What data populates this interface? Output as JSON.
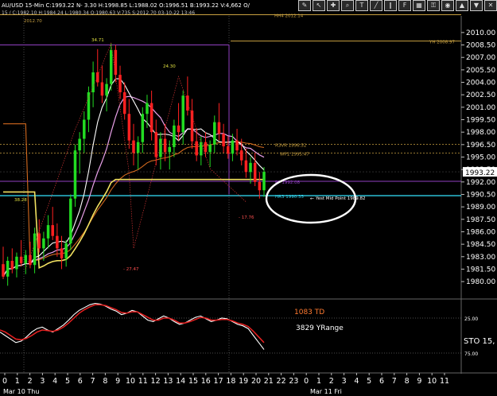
{
  "header": {
    "symbol_line": "AU/USD 15-Min  C:1993.22 N-  3.30 H:1998.85 L:1988.02 O:1996.51 B:1993.22 V:4,662 O/",
    "line2": "15 / C:1982.10 H:1984.24 L:1980.34 O:1980.63 V:735 S:2012.70 03-10-22 13:46"
  },
  "toolbar": {
    "icons": [
      "brush-icon",
      "cursor-icon",
      "crosshair-icon",
      "zoom-icon",
      "text-icon",
      "line-icon",
      "channel-icon",
      "fib-icon",
      "grid-icon",
      "lock-icon",
      "eye-icon",
      "up-icon",
      "down-icon",
      "close-icon"
    ]
  },
  "chart_data": [
    {
      "type": "candlestick",
      "title": "",
      "ylim": [
        1978.0,
        2012.0
      ],
      "price_ticks": [
        "2010.00",
        "2008.50",
        "2007.00",
        "2005.50",
        "2004.00",
        "2002.50",
        "2001.00",
        "1999.50",
        "1998.00",
        "1996.50",
        "1995.00",
        "1993.50",
        "1992.00",
        "1990.50",
        "1989.00",
        "1987.50",
        "1986.00",
        "1984.50",
        "1983.00",
        "1981.50",
        "1980.00"
      ],
      "current_price": "1993.22",
      "series": [
        {
          "name": "HH4",
          "label": "HH4 2012.14",
          "values": [
            2012.14
          ]
        },
        {
          "name": "YH",
          "label": "YH 2008.97",
          "values": [
            2008.97
          ]
        },
        {
          "name": "R3VR",
          "label": "R3VR 1996.52",
          "values": [
            1996.52
          ]
        },
        {
          "name": "WP1",
          "label": "WP1 1995.47",
          "values": [
            1995.47
          ]
        },
        {
          "name": "PP",
          "label": "PP 1992.08",
          "values": [
            1992.08
          ]
        },
        {
          "name": "HR3",
          "label": "HR3 1990.35",
          "values": [
            1990.35
          ]
        }
      ],
      "annotations": [
        {
          "text": "34.71"
        },
        {
          "text": "24.30"
        },
        {
          "text": "- 27.47"
        },
        {
          "text": "- 17.76"
        },
        {
          "text": "38.28"
        },
        {
          "text": "2012.70"
        },
        {
          "text": "Yest Mid Point 1989.82"
        }
      ],
      "candles": [
        [
          1982.1,
          1984.2,
          1980.3,
          1980.6
        ],
        [
          1980.6,
          1983.0,
          1979.5,
          1982.5
        ],
        [
          1982.5,
          1984.0,
          1981.0,
          1981.5
        ],
        [
          1981.5,
          1983.5,
          1980.5,
          1983.0
        ],
        [
          1983.0,
          1985.0,
          1981.8,
          1982.2
        ],
        [
          1982.2,
          1983.8,
          1980.9,
          1983.2
        ],
        [
          1983.2,
          1984.8,
          1981.6,
          1982.0
        ],
        [
          1982.0,
          1986.5,
          1981.0,
          1985.8
        ],
        [
          1985.8,
          1987.5,
          1983.5,
          1984.0
        ],
        [
          1984.0,
          1986.0,
          1982.5,
          1985.2
        ],
        [
          1985.2,
          1988.0,
          1984.0,
          1986.8
        ],
        [
          1986.8,
          1989.0,
          1985.0,
          1985.5
        ],
        [
          1985.5,
          1987.0,
          1983.0,
          1984.0
        ],
        [
          1984.0,
          1985.5,
          1981.5,
          1982.8
        ],
        [
          1982.8,
          1985.0,
          1981.8,
          1984.6
        ],
        [
          1984.6,
          1990.5,
          1983.8,
          1990.0
        ],
        [
          1990.0,
          1996.5,
          1989.0,
          1995.8
        ],
        [
          1995.8,
          1998.0,
          1993.0,
          1997.2
        ],
        [
          1997.2,
          2000.5,
          1995.5,
          1999.5
        ],
        [
          1999.5,
          2003.5,
          1998.0,
          2002.8
        ],
        [
          2002.8,
          2006.5,
          2001.0,
          2005.2
        ],
        [
          2005.2,
          2008.0,
          2003.5,
          2004.0
        ],
        [
          2004.0,
          2006.0,
          2001.5,
          2002.4
        ],
        [
          2002.4,
          2004.5,
          2000.5,
          2003.8
        ],
        [
          2003.8,
          2008.7,
          2003.0,
          2007.9
        ],
        [
          2007.9,
          2008.5,
          2004.0,
          2004.9
        ],
        [
          2004.9,
          2006.0,
          2002.0,
          2002.8
        ],
        [
          2002.8,
          2004.0,
          1999.5,
          2000.2
        ],
        [
          2000.2,
          2002.0,
          1996.0,
          1997.0
        ],
        [
          1997.0,
          1999.0,
          1994.0,
          1995.5
        ],
        [
          1995.5,
          1997.5,
          1993.5,
          1996.8
        ],
        [
          1996.8,
          2001.0,
          1995.5,
          2000.2
        ],
        [
          2000.2,
          2002.5,
          1998.5,
          2001.5
        ],
        [
          2001.5,
          2003.0,
          1997.0,
          1998.0
        ],
        [
          1998.0,
          1999.5,
          1994.0,
          1995.0
        ],
        [
          1995.0,
          1998.0,
          1993.5,
          1997.2
        ],
        [
          1997.2,
          1999.0,
          1994.5,
          1995.6
        ],
        [
          1995.6,
          1997.0,
          1993.5,
          1996.2
        ],
        [
          1996.2,
          1999.5,
          1995.0,
          1998.8
        ],
        [
          1998.8,
          2001.5,
          1997.0,
          1998.0
        ],
        [
          1998.0,
          2003.0,
          1996.5,
          2002.4
        ],
        [
          2002.4,
          2004.7,
          2000.0,
          2000.6
        ],
        [
          2000.6,
          2002.0,
          1996.0,
          1996.9
        ],
        [
          1996.9,
          1998.5,
          1994.5,
          1995.2
        ],
        [
          1995.2,
          1997.5,
          1994.0,
          1996.8
        ],
        [
          1996.8,
          1998.0,
          1995.0,
          1995.6
        ],
        [
          1995.6,
          1997.0,
          1993.8,
          1996.5
        ],
        [
          1996.5,
          2000.0,
          1995.5,
          1999.2
        ],
        [
          1999.2,
          2001.5,
          1997.0,
          1997.8
        ],
        [
          1997.8,
          1999.0,
          1995.5,
          1996.3
        ],
        [
          1996.3,
          1997.5,
          1994.8,
          1995.4
        ],
        [
          1995.4,
          1997.8,
          1994.5,
          1997.0
        ],
        [
          1997.0,
          1998.4,
          1995.2,
          1995.8
        ],
        [
          1995.8,
          1997.2,
          1994.0,
          1994.6
        ],
        [
          1994.6,
          1996.0,
          1992.5,
          1993.2
        ],
        [
          1993.2,
          1995.0,
          1991.8,
          1994.3
        ],
        [
          1994.3,
          1995.5,
          1991.5,
          1992.0
        ],
        [
          1992.0,
          1993.2,
          1990.0,
          1991.0
        ],
        [
          1991.0,
          1993.8,
          1990.2,
          1993.22
        ]
      ],
      "xaxis_ticks": [
        "0",
        "1",
        "2",
        "3",
        "4",
        "5",
        "6",
        "7",
        "8",
        "9",
        "10",
        "11",
        "12",
        "13",
        "14",
        "15",
        "16",
        "17",
        "18",
        "19",
        "20",
        "21",
        "22",
        "23",
        "0",
        "1",
        "2",
        "3",
        "4",
        "5",
        "6",
        "7",
        "8",
        "9",
        "10",
        "11"
      ],
      "date_labels": [
        "Mar 10 Thu",
        "Mar 11 Fri"
      ]
    },
    {
      "type": "line",
      "title": "",
      "ylim": [
        0,
        100
      ],
      "tick_labels": [
        "25.00",
        "75.00"
      ],
      "annotations": [
        "1083 TD",
        "3829 YRange",
        "STO 15,"
      ],
      "series": [
        {
          "name": "STO-fast",
          "values": [
            55,
            50,
            45,
            40,
            42,
            48,
            55,
            60,
            62,
            58,
            55,
            60,
            65,
            72,
            80,
            86,
            90,
            94,
            96,
            95,
            92,
            88,
            85,
            80,
            82,
            86,
            84,
            78,
            72,
            70,
            74,
            78,
            75,
            70,
            66,
            68,
            72,
            76,
            78,
            74,
            70,
            72,
            75,
            74,
            70,
            66,
            64,
            60,
            50,
            40,
            30
          ]
        },
        {
          "name": "STO-slow",
          "values": [
            58,
            55,
            50,
            45,
            44,
            46,
            50,
            55,
            58,
            57,
            56,
            58,
            62,
            68,
            75,
            82,
            87,
            91,
            94,
            94,
            93,
            90,
            87,
            83,
            82,
            84,
            84,
            80,
            76,
            72,
            72,
            75,
            75,
            72,
            68,
            68,
            70,
            73,
            76,
            75,
            72,
            72,
            73,
            73,
            71,
            68,
            66,
            63,
            56,
            48,
            40
          ]
        }
      ]
    }
  ],
  "colors": {
    "bg": "#000000",
    "bull": "#22dd22",
    "bear": "#ff2020",
    "sma_pink": "#e8a0e8",
    "sma_white": "#ffffff",
    "ema_orange": "#d2691e",
    "ema_yellow": "#f0e060",
    "cyan_line": "#30d0e8",
    "level_gold": "#c8a040",
    "level_violet": "#9040c0",
    "sto_red": "#e82020",
    "ellipse": "#ffffff"
  }
}
